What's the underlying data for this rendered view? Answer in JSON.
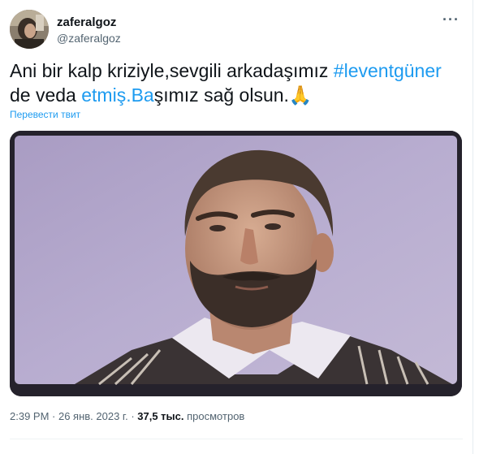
{
  "author": {
    "display_name": "zaferalgoz",
    "handle": "@zaferalgoz"
  },
  "more_label": "···",
  "tweet": {
    "text_1": "Ani bir kalp kriziyle,sevgili arkadaşımız ",
    "hashtag": "#leventgüner",
    "text_2": "de veda ",
    "link_text": "etmiş.Ba",
    "text_3": "şımız sağ olsun.",
    "emoji": "🙏"
  },
  "translate_label": "Перевести твит",
  "meta": {
    "time": "2:39 PM",
    "separator": " · ",
    "date": "26 янв. 2023 г.",
    "views_count": "37,5 тыс.",
    "views_label": "просмотров"
  },
  "colors": {
    "link": "#1d9bf0",
    "secondary_text": "#536471"
  }
}
